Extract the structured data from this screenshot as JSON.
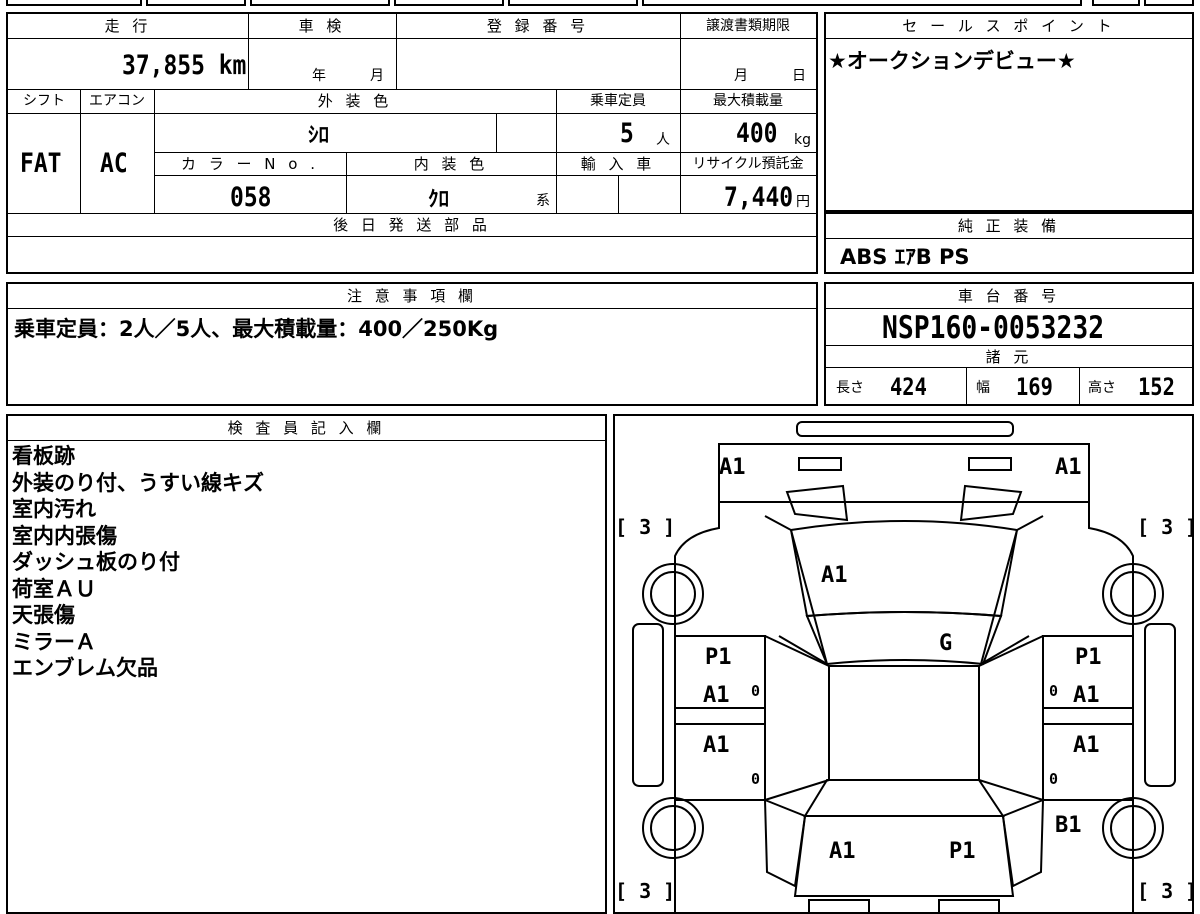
{
  "header": {
    "mileage_label": "走 行",
    "inspection_label": "車 検",
    "registration_label": "登 録 番 号",
    "transfer_deadline_label": "譲渡書類期限",
    "mileage_value": "37,855 km",
    "inspection_year": "年",
    "inspection_month": "月",
    "deadline_month": "月",
    "deadline_day": "日"
  },
  "specs": {
    "shift_label": "シフト",
    "ac_label": "エアコン",
    "exterior_color_label": "外 装 色",
    "capacity_label": "乗車定員",
    "max_load_label": "最大積載量",
    "shift_value": "FAT",
    "ac_value": "AC",
    "exterior_color_value": "ｼﾛ",
    "capacity_value": "5",
    "capacity_unit": "人",
    "max_load_value": "400",
    "max_load_unit": "kg",
    "color_no_label": "カ ラ ー N o .",
    "interior_color_label": "内 装 色",
    "import_label": "輸 入 車",
    "recycle_label": "リサイクル預託金",
    "color_no_value": "058",
    "interior_color_value": "ｸﾛ",
    "interior_suffix": "系",
    "recycle_value": "7,440",
    "recycle_unit": "円"
  },
  "later_parts": {
    "label": "後 日 発 送 部 品",
    "value": ""
  },
  "sales_point": {
    "label": "セ ー ル ス ポ イ ン ト",
    "value": "★オークションデビュー★"
  },
  "genuine_equipment": {
    "label": "純 正 装 備",
    "value": "ABS ｴｱB PS"
  },
  "notes": {
    "label": "注 意 事 項 欄",
    "value": "乗車定員：2人／5人、最大積載量：400／250Kg"
  },
  "chassis": {
    "label": "車 台 番 号",
    "value": "NSP160-0053232"
  },
  "dimensions": {
    "label": "諸 元",
    "length_label": "長さ",
    "length_value": "424",
    "width_label": "幅",
    "width_value": "169",
    "height_label": "高さ",
    "height_value": "152"
  },
  "inspector": {
    "label": "検 査 員 記 入 欄",
    "items": [
      "看板跡",
      "外装のり付、うすい線キズ",
      "室内汚れ",
      "室内内張傷",
      "ダッシュ板のり付",
      "荷室ＡＵ",
      "天張傷",
      "ミラーＡ",
      "エンブレム欠品"
    ]
  },
  "diagram": {
    "marks": {
      "rear_left": "A1",
      "rear_right": "A1",
      "tire_rear_left": "[ 3 ]",
      "tire_rear_right": "[ 3 ]",
      "roof_rear": "A1",
      "roof_glass": "G",
      "door_rl_top": "P1",
      "door_rl_bottom": "A1",
      "door_rr_top": "P1",
      "door_rr_bottom": "A1",
      "door_fl": "A1",
      "door_fr": "A1",
      "fender_fr": "B1",
      "hood_left": "A1",
      "hood_right": "P1",
      "tire_front_left": "[ 3 ]",
      "tire_front_right": "[ 3 ]",
      "door_rl_small": "0",
      "door_rr_small": "0",
      "door_fl_small": "0",
      "door_fr_small": "0"
    }
  }
}
